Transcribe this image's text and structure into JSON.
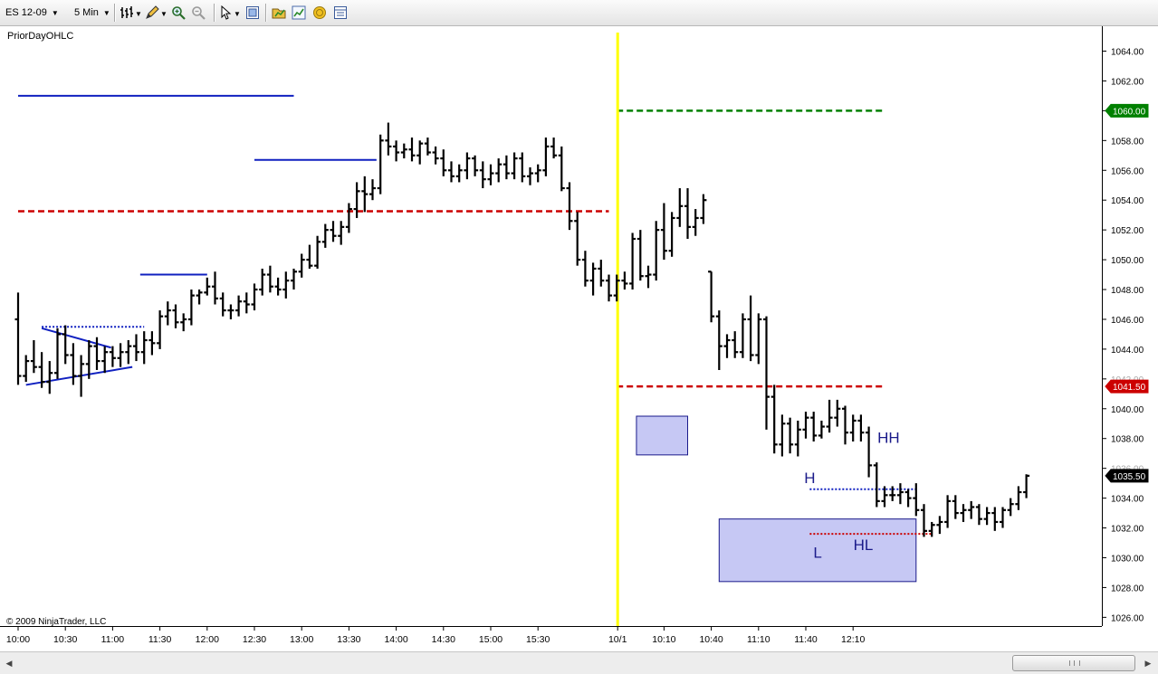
{
  "toolbar": {
    "instrument": "ES 12-09",
    "interval": "5 Min",
    "icons": [
      "bar-style-icon",
      "draw-pencil-icon",
      "zoom-in-icon",
      "zoom-out-icon",
      "pointer-icon",
      "properties-icon",
      "strategy-icon",
      "indicators-icon",
      "coins-icon",
      "data-box-icon"
    ]
  },
  "chart": {
    "indicator_label": "PriorDayOHLC",
    "copyright": "© 2009 NinjaTrader, LLC",
    "last_price": "1035.50",
    "colors": {
      "bars": "#000000",
      "session_break": "#ffff00",
      "level_high": "#008000",
      "level_low": "#cc0000",
      "drawing": "#1020c0",
      "zone_fill": "#c6c8f4",
      "zone_border": "#1a1a8a",
      "price_marker_last": "#000000"
    }
  },
  "chart_data": {
    "type": "ohlc",
    "instrument": "ES 12-09",
    "interval": "5 Min",
    "ylim": [
      1025.5,
      1065.0
    ],
    "y_ticks": [
      1026,
      1028,
      1030,
      1032,
      1034,
      1036,
      1038,
      1040,
      1042,
      1044,
      1046,
      1048,
      1050,
      1052,
      1054,
      1056,
      1058,
      1060,
      1062,
      1064
    ],
    "y_tick_labels": [
      "1026.00",
      "1028.00",
      "1030.00",
      "1032.00",
      "1034.00",
      "1036.00",
      "1038.00",
      "1040.00",
      "1042.00",
      "1044.00",
      "1046.00",
      "1048.00",
      "1050.00",
      "1052.00",
      "1054.00",
      "1056.00",
      "1058.00",
      "1060.00",
      "1062.00",
      "1064.00"
    ],
    "x_tick_labels": [
      {
        "label": "10:00",
        "bar": 0
      },
      {
        "label": "10:30",
        "bar": 6
      },
      {
        "label": "11:00",
        "bar": 12
      },
      {
        "label": "11:30",
        "bar": 18
      },
      {
        "label": "12:00",
        "bar": 24
      },
      {
        "label": "12:30",
        "bar": 30
      },
      {
        "label": "13:00",
        "bar": 36
      },
      {
        "label": "13:30",
        "bar": 42
      },
      {
        "label": "14:00",
        "bar": 48
      },
      {
        "label": "14:30",
        "bar": 54
      },
      {
        "label": "15:00",
        "bar": 60
      },
      {
        "label": "15:30",
        "bar": 66
      },
      {
        "label": "10/1",
        "bar": 76
      },
      {
        "label": "10:10",
        "bar": 82
      },
      {
        "label": "10:40",
        "bar": 88
      },
      {
        "label": "11:10",
        "bar": 94
      },
      {
        "label": "11:40",
        "bar": 100
      },
      {
        "label": "12:10",
        "bar": 106
      }
    ],
    "session_break_bar": 76,
    "price_markers": [
      {
        "label": "1060.00",
        "value": 1060.0,
        "color": "#008000"
      },
      {
        "label": "1041.50",
        "value": 1041.5,
        "color": "#cc0000"
      },
      {
        "label": "1035.50",
        "value": 1035.5,
        "color": "#000000"
      }
    ],
    "hidden_tick_labels": [
      "1042.00",
      "1036.00"
    ],
    "prior_day_levels": [
      {
        "name": "prior-day-high",
        "value": 1060.0,
        "from_bar": 76,
        "to_bar": 110,
        "color": "#008000"
      },
      {
        "name": "prior-day-low",
        "value": 1041.5,
        "from_bar": 76,
        "to_bar": 110,
        "color": "#cc0000"
      },
      {
        "name": "prior-day-open",
        "value": 1053.25,
        "from_bar": 0,
        "to_bar": 75,
        "color": "#cc0000"
      }
    ],
    "annotations": [
      {
        "text": "H",
        "bar": 100.5,
        "price": 1035.0
      },
      {
        "text": "L",
        "bar": 101.5,
        "price": 1030.0
      },
      {
        "text": "HL",
        "bar": 107.3,
        "price": 1030.5
      },
      {
        "text": "HH",
        "bar": 110.5,
        "price": 1037.7
      }
    ],
    "bars": [
      [
        1046.0,
        1047.8,
        1041.6,
        1042.2
      ],
      [
        1042.2,
        1043.6,
        1041.8,
        1043.2
      ],
      [
        1043.2,
        1044.6,
        1042.4,
        1042.8
      ],
      [
        1042.8,
        1043.8,
        1041.4,
        1041.8
      ],
      [
        1041.8,
        1043.2,
        1041.0,
        1042.4
      ],
      [
        1042.4,
        1045.4,
        1042.0,
        1045.0
      ],
      [
        1045.0,
        1045.6,
        1043.0,
        1043.6
      ],
      [
        1043.6,
        1044.4,
        1041.6,
        1042.2
      ],
      [
        1042.2,
        1043.6,
        1040.8,
        1043.0
      ],
      [
        1043.0,
        1044.6,
        1042.0,
        1044.2
      ],
      [
        1044.2,
        1044.8,
        1042.6,
        1043.2
      ],
      [
        1043.2,
        1044.2,
        1042.4,
        1043.8
      ],
      [
        1043.8,
        1044.2,
        1042.8,
        1043.4
      ],
      [
        1043.4,
        1044.4,
        1042.8,
        1043.8
      ],
      [
        1043.8,
        1044.6,
        1043.0,
        1044.2
      ],
      [
        1044.2,
        1045.0,
        1043.2,
        1043.8
      ],
      [
        1043.8,
        1045.2,
        1043.0,
        1044.6
      ],
      [
        1044.6,
        1045.2,
        1043.6,
        1044.4
      ],
      [
        1044.4,
        1046.6,
        1044.0,
        1046.2
      ],
      [
        1046.2,
        1047.2,
        1045.6,
        1046.6
      ],
      [
        1046.6,
        1047.0,
        1045.4,
        1045.8
      ],
      [
        1045.8,
        1046.4,
        1045.2,
        1046.0
      ],
      [
        1046.0,
        1048.0,
        1045.6,
        1047.6
      ],
      [
        1047.6,
        1048.0,
        1047.0,
        1047.8
      ],
      [
        1047.8,
        1048.8,
        1047.6,
        1048.2
      ],
      [
        1048.2,
        1049.2,
        1047.0,
        1047.4
      ],
      [
        1047.4,
        1047.8,
        1046.2,
        1046.6
      ],
      [
        1046.6,
        1047.0,
        1046.0,
        1046.6
      ],
      [
        1046.6,
        1047.6,
        1046.2,
        1047.2
      ],
      [
        1047.2,
        1047.8,
        1046.4,
        1047.0
      ],
      [
        1047.0,
        1048.4,
        1046.6,
        1048.0
      ],
      [
        1048.0,
        1049.4,
        1047.6,
        1049.0
      ],
      [
        1049.0,
        1049.6,
        1047.8,
        1048.2
      ],
      [
        1048.2,
        1048.8,
        1047.6,
        1048.0
      ],
      [
        1048.0,
        1049.2,
        1047.4,
        1048.6
      ],
      [
        1048.6,
        1049.4,
        1048.0,
        1049.2
      ],
      [
        1049.2,
        1050.4,
        1048.8,
        1050.0
      ],
      [
        1050.0,
        1051.0,
        1049.4,
        1049.6
      ],
      [
        1049.6,
        1051.6,
        1049.4,
        1051.2
      ],
      [
        1051.2,
        1052.4,
        1050.8,
        1052.0
      ],
      [
        1052.0,
        1052.6,
        1051.2,
        1051.6
      ],
      [
        1051.6,
        1052.6,
        1051.0,
        1052.2
      ],
      [
        1052.2,
        1053.8,
        1051.8,
        1053.4
      ],
      [
        1053.4,
        1055.2,
        1052.8,
        1054.6
      ],
      [
        1054.6,
        1055.6,
        1053.2,
        1054.4
      ],
      [
        1054.4,
        1055.4,
        1054.0,
        1054.8
      ],
      [
        1054.8,
        1058.4,
        1054.4,
        1058.0
      ],
      [
        1058.0,
        1059.2,
        1057.0,
        1057.6
      ],
      [
        1057.6,
        1058.0,
        1056.6,
        1057.2
      ],
      [
        1057.2,
        1057.8,
        1056.8,
        1057.4
      ],
      [
        1057.4,
        1058.2,
        1056.6,
        1057.0
      ],
      [
        1057.0,
        1058.0,
        1056.4,
        1057.8
      ],
      [
        1057.8,
        1058.2,
        1057.0,
        1057.2
      ],
      [
        1057.2,
        1057.6,
        1056.4,
        1056.8
      ],
      [
        1056.8,
        1057.4,
        1055.6,
        1056.0
      ],
      [
        1056.0,
        1056.6,
        1055.2,
        1055.6
      ],
      [
        1055.6,
        1056.4,
        1055.2,
        1056.0
      ],
      [
        1056.0,
        1057.2,
        1055.4,
        1056.8
      ],
      [
        1056.8,
        1057.0,
        1055.6,
        1056.0
      ],
      [
        1056.0,
        1056.6,
        1054.8,
        1055.4
      ],
      [
        1055.4,
        1056.4,
        1055.0,
        1055.8
      ],
      [
        1055.8,
        1056.8,
        1055.2,
        1056.4
      ],
      [
        1056.4,
        1057.0,
        1055.4,
        1055.8
      ],
      [
        1055.8,
        1057.2,
        1055.4,
        1056.8
      ],
      [
        1056.8,
        1057.2,
        1055.2,
        1055.6
      ],
      [
        1055.6,
        1056.2,
        1055.0,
        1055.8
      ],
      [
        1055.8,
        1056.4,
        1055.2,
        1056.0
      ],
      [
        1056.0,
        1058.2,
        1055.6,
        1057.6
      ],
      [
        1057.6,
        1058.2,
        1056.8,
        1057.0
      ],
      [
        1057.0,
        1057.6,
        1054.6,
        1054.8
      ],
      [
        1054.8,
        1055.2,
        1052.0,
        1052.6
      ],
      [
        1052.6,
        1053.2,
        1049.6,
        1050.0
      ],
      [
        1050.0,
        1050.6,
        1048.2,
        1048.6
      ],
      [
        1048.6,
        1049.8,
        1047.6,
        1049.4
      ],
      [
        1049.4,
        1050.0,
        1048.2,
        1048.6
      ],
      [
        1048.6,
        1049.0,
        1047.2,
        1047.6
      ],
      [
        1047.6,
        1049.0,
        1047.2,
        1048.6
      ],
      [
        1048.6,
        1049.2,
        1048.0,
        1048.4
      ],
      [
        1048.4,
        1051.8,
        1048.0,
        1051.4
      ],
      [
        1051.4,
        1052.0,
        1048.6,
        1048.9
      ],
      [
        1048.9,
        1049.6,
        1048.1,
        1049.0
      ],
      [
        1049.0,
        1052.6,
        1048.6,
        1052.0
      ],
      [
        1052.0,
        1053.8,
        1050.0,
        1050.6
      ],
      [
        1050.6,
        1053.2,
        1050.2,
        1052.8
      ],
      [
        1052.8,
        1054.8,
        1052.2,
        1053.6
      ],
      [
        1053.6,
        1054.8,
        1051.4,
        1052.2
      ],
      [
        1052.2,
        1053.4,
        1051.6,
        1052.8
      ],
      [
        1052.8,
        1054.4,
        1052.4,
        1054.0
      ],
      [
        1049.2,
        1049.2,
        1045.8,
        1046.2
      ],
      [
        1046.2,
        1046.6,
        1042.6,
        1044.2
      ],
      [
        1044.2,
        1045.0,
        1043.4,
        1044.6
      ],
      [
        1044.6,
        1045.2,
        1043.4,
        1043.8
      ],
      [
        1043.8,
        1046.4,
        1043.4,
        1046.0
      ],
      [
        1046.0,
        1047.6,
        1043.2,
        1043.6
      ],
      [
        1043.6,
        1046.4,
        1043.0,
        1046.0
      ],
      [
        1046.0,
        1046.2,
        1038.6,
        1040.8
      ],
      [
        1040.8,
        1041.6,
        1037.0,
        1037.6
      ],
      [
        1037.6,
        1039.6,
        1036.8,
        1039.0
      ],
      [
        1039.0,
        1039.4,
        1037.0,
        1037.6
      ],
      [
        1037.6,
        1039.2,
        1036.8,
        1038.6
      ],
      [
        1038.6,
        1039.8,
        1038.0,
        1039.4
      ],
      [
        1039.4,
        1039.8,
        1037.8,
        1038.2
      ],
      [
        1038.2,
        1039.2,
        1038.0,
        1038.8
      ],
      [
        1038.8,
        1040.6,
        1038.4,
        1039.4
      ],
      [
        1039.4,
        1040.6,
        1038.8,
        1040.0
      ],
      [
        1040.0,
        1040.2,
        1037.6,
        1038.4
      ],
      [
        1038.4,
        1039.6,
        1037.8,
        1039.2
      ],
      [
        1039.2,
        1039.6,
        1037.8,
        1038.4
      ],
      [
        1038.4,
        1038.8,
        1035.4,
        1036.2
      ],
      [
        1036.2,
        1036.4,
        1033.4,
        1033.8
      ],
      [
        1033.8,
        1034.8,
        1033.4,
        1034.2
      ],
      [
        1034.2,
        1034.8,
        1033.8,
        1034.2
      ],
      [
        1034.2,
        1035.0,
        1033.6,
        1034.4
      ],
      [
        1034.4,
        1034.6,
        1033.4,
        1034.0
      ],
      [
        1034.0,
        1035.0,
        1032.8,
        1033.2
      ],
      [
        1033.2,
        1033.6,
        1031.4,
        1031.8
      ],
      [
        1031.8,
        1032.4,
        1031.4,
        1032.2
      ],
      [
        1032.2,
        1032.8,
        1031.6,
        1032.4
      ],
      [
        1032.4,
        1034.2,
        1032.0,
        1033.8
      ],
      [
        1033.8,
        1034.2,
        1032.6,
        1033.0
      ],
      [
        1033.0,
        1033.6,
        1032.4,
        1033.2
      ],
      [
        1033.2,
        1033.8,
        1032.6,
        1033.4
      ],
      [
        1033.4,
        1033.6,
        1032.2,
        1032.6
      ],
      [
        1032.6,
        1033.4,
        1032.2,
        1033.0
      ],
      [
        1033.0,
        1033.4,
        1031.8,
        1032.4
      ],
      [
        1032.4,
        1033.4,
        1032.0,
        1033.2
      ],
      [
        1033.2,
        1034.0,
        1032.8,
        1033.6
      ],
      [
        1033.6,
        1034.8,
        1033.2,
        1034.4
      ],
      [
        1034.4,
        1035.6,
        1034.0,
        1035.5
      ]
    ],
    "drawings": [
      {
        "kind": "line",
        "name": "resistance-line-left",
        "from": [
          0,
          1061.0
        ],
        "to": [
          35,
          1061.0
        ],
        "style": "solid",
        "color": "#1020c0"
      },
      {
        "kind": "line",
        "name": "triangle-upper-trendline",
        "from": [
          3,
          1045.4
        ],
        "to": [
          11.8,
          1044.1
        ],
        "style": "solid",
        "color": "#1020c0"
      },
      {
        "kind": "line",
        "name": "triangle-lower-trendline",
        "from": [
          1,
          1041.6
        ],
        "to": [
          14.5,
          1042.8
        ],
        "style": "solid",
        "color": "#1020c0"
      },
      {
        "kind": "line",
        "name": "breakout-level-line",
        "from": [
          3,
          1045.5
        ],
        "to": [
          16,
          1045.5
        ],
        "style": "dotted",
        "color": "#1020c0"
      },
      {
        "kind": "line",
        "name": "consolidation-line-1",
        "from": [
          15.5,
          1049.0
        ],
        "to": [
          24,
          1049.0
        ],
        "style": "solid",
        "color": "#1020c0"
      },
      {
        "kind": "line",
        "name": "consolidation-line-2",
        "from": [
          30,
          1056.7
        ],
        "to": [
          45.5,
          1056.7
        ],
        "style": "solid",
        "color": "#1020c0"
      },
      {
        "kind": "line",
        "name": "high-level-line",
        "from": [
          100.5,
          1034.6
        ],
        "to": [
          114,
          1034.6
        ],
        "style": "dotted",
        "color": "#1020c0"
      },
      {
        "kind": "line",
        "name": "higher-low-line",
        "from": [
          100.5,
          1031.6
        ],
        "to": [
          116,
          1031.6
        ],
        "style": "dotted",
        "color": "#cc0000"
      },
      {
        "kind": "zone",
        "name": "demand-zone-upper",
        "x_from": 78.5,
        "x_to": 85,
        "y_from": 1036.9,
        "y_to": 1039.5
      },
      {
        "kind": "zone",
        "name": "demand-zone-lower",
        "x_from": 89,
        "x_to": 114,
        "y_from": 1028.4,
        "y_to": 1032.6
      }
    ]
  }
}
